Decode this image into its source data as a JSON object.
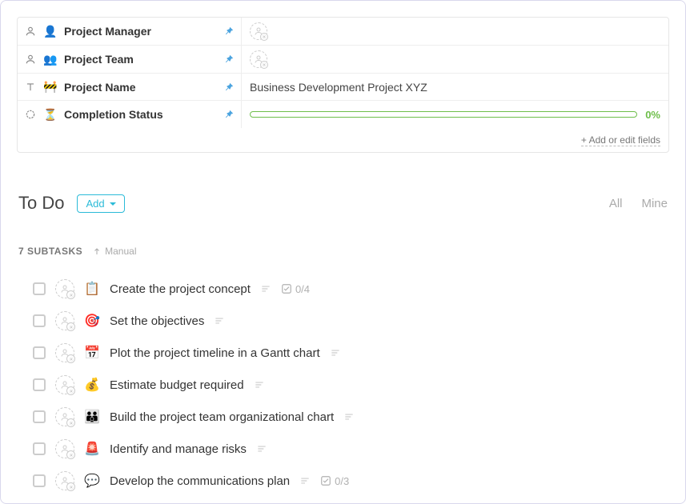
{
  "fields": [
    {
      "type_icon": "person",
      "emoji": "👤",
      "label": "Project Manager",
      "pinned": true,
      "value_kind": "avatar",
      "value": ""
    },
    {
      "type_icon": "person",
      "emoji": "👥",
      "label": "Project Team",
      "pinned": true,
      "value_kind": "avatar",
      "value": ""
    },
    {
      "type_icon": "text",
      "emoji": "🚧",
      "label": "Project Name",
      "pinned": true,
      "value_kind": "text",
      "value": "Business Development Project XYZ"
    },
    {
      "type_icon": "progress",
      "emoji": "⏳",
      "label": "Completion Status",
      "pinned": true,
      "value_kind": "progress",
      "value": "0%"
    }
  ],
  "fields_footer": "+ Add or edit fields",
  "section": {
    "title": "To Do",
    "add_label": "Add",
    "filter_all": "All",
    "filter_mine": "Mine"
  },
  "subtasks_meta": {
    "count_label": "7 SUBTASKS",
    "sort_label": "Manual"
  },
  "tasks": [
    {
      "emoji": "📋",
      "title": "Create the project concept",
      "has_desc": true,
      "counter": "0/4"
    },
    {
      "emoji": "🎯",
      "title": "Set the objectives",
      "has_desc": true,
      "counter": ""
    },
    {
      "emoji": "📅",
      "title": "Plot the project timeline in a Gantt chart",
      "has_desc": true,
      "counter": ""
    },
    {
      "emoji": "💰",
      "title": "Estimate budget required",
      "has_desc": true,
      "counter": ""
    },
    {
      "emoji": "👪",
      "title": "Build the project team organizational chart",
      "has_desc": true,
      "counter": ""
    },
    {
      "emoji": "🚨",
      "title": "Identify and manage risks",
      "has_desc": true,
      "counter": ""
    },
    {
      "emoji": "💬",
      "title": "Develop the communications plan",
      "has_desc": true,
      "counter": "0/3"
    }
  ]
}
